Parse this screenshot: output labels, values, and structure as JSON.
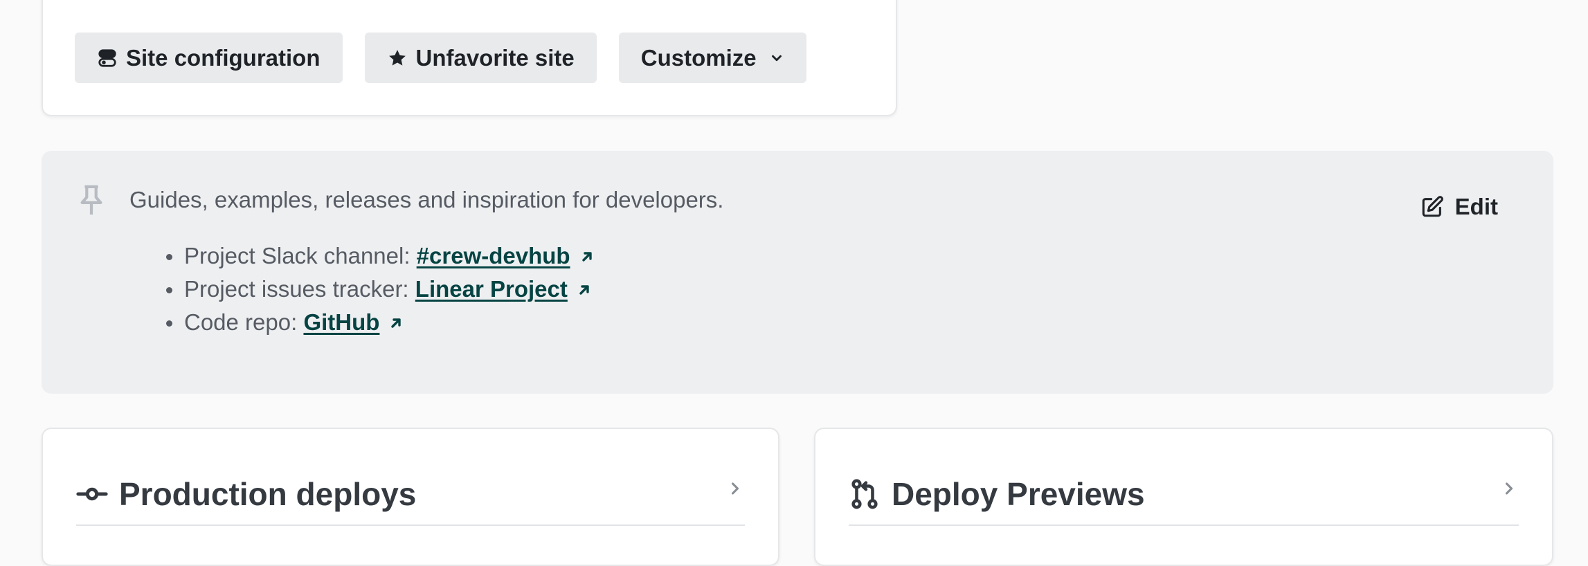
{
  "actions": {
    "site_configuration": "Site configuration",
    "unfavorite_site": "Unfavorite site",
    "customize": "Customize"
  },
  "pinned": {
    "description": "Guides, examples, releases and inspiration for developers.",
    "edit_label": "Edit",
    "items": [
      {
        "label": "Project Slack channel: ",
        "link": "#crew-devhub"
      },
      {
        "label": "Project issues tracker: ",
        "link": "Linear Project"
      },
      {
        "label": "Code repo: ",
        "link": "GitHub"
      }
    ]
  },
  "sections": {
    "production": {
      "title": "Production deploys",
      "icon": "commit-icon"
    },
    "previews": {
      "title": "Deploy Previews",
      "icon": "pull-request-icon"
    }
  },
  "colors": {
    "link": "#064443",
    "button_bg": "#e9eaec",
    "panel_bg": "#eeeff1"
  }
}
